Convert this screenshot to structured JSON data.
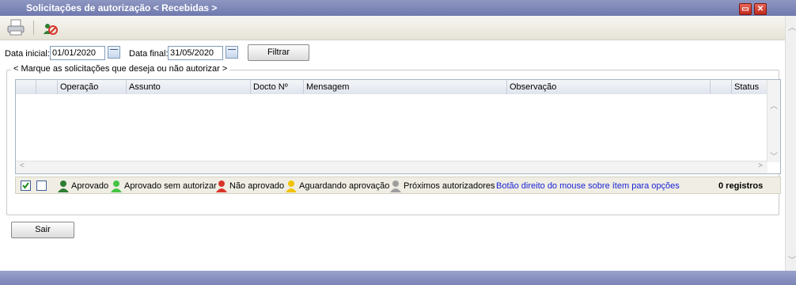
{
  "window": {
    "title": "Solicitações de autorização < Recebidas >"
  },
  "filters": {
    "start_label": "Data inicial:",
    "start_value": "01/01/2020",
    "end_label": "Data final:",
    "end_value": "31/05/2020",
    "filter_button": "Filtrar"
  },
  "group": {
    "legend": "< Marque as solicitações que deseja ou não autorizar >"
  },
  "grid": {
    "columns": [
      "Operação",
      "Assunto",
      "Docto Nº",
      "Mensagem",
      "Observação",
      "Status"
    ],
    "rows": []
  },
  "legend": {
    "approved": "Aprovado",
    "approved_no_auth": "Aprovado sem autorizar",
    "not_approved": "Não aprovado",
    "waiting": "Aguardando aprovação",
    "next": "Próximos autorizadores",
    "hint": "Botão direito do mouse sobre ítem para opções",
    "count": "0 registros",
    "colors": {
      "approved": "#2e7d32",
      "approved_no_auth": "#43c443",
      "not_approved": "#d9352b",
      "waiting": "#f2c200",
      "next": "#9e9e9e",
      "hint": "#1a23d6"
    }
  },
  "actions": {
    "exit_button": "Sair"
  }
}
